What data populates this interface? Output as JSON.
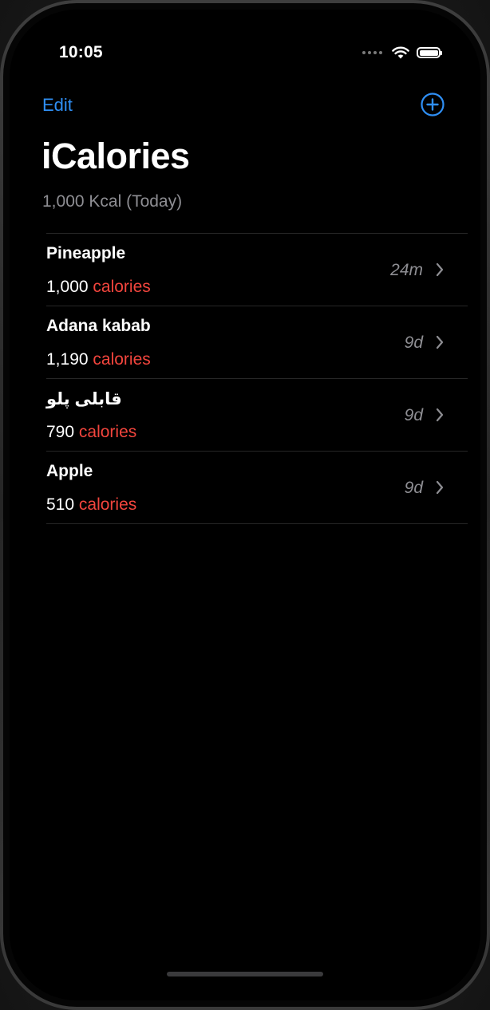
{
  "status_bar": {
    "time": "10:05",
    "battery_level": 1.0
  },
  "nav": {
    "edit_label": "Edit",
    "add_icon": "plus-circle-icon"
  },
  "header": {
    "title": "iCalories",
    "subtitle": "1,000 Kcal (Today)"
  },
  "foods": [
    {
      "name": "Pineapple",
      "calories": "1,000",
      "unit": "calories",
      "time": "24m"
    },
    {
      "name": "Adana kabab",
      "calories": "1,190",
      "unit": "calories",
      "time": "9d"
    },
    {
      "name": "قابلی پلو",
      "calories": "790",
      "unit": "calories",
      "time": "9d"
    },
    {
      "name": "Apple",
      "calories": "510",
      "unit": "calories",
      "time": "9d"
    }
  ],
  "colors": {
    "accent": "#2f8ff5",
    "calories_text": "#f2453d",
    "secondary_text": "#8e8e93",
    "background": "#000000"
  }
}
